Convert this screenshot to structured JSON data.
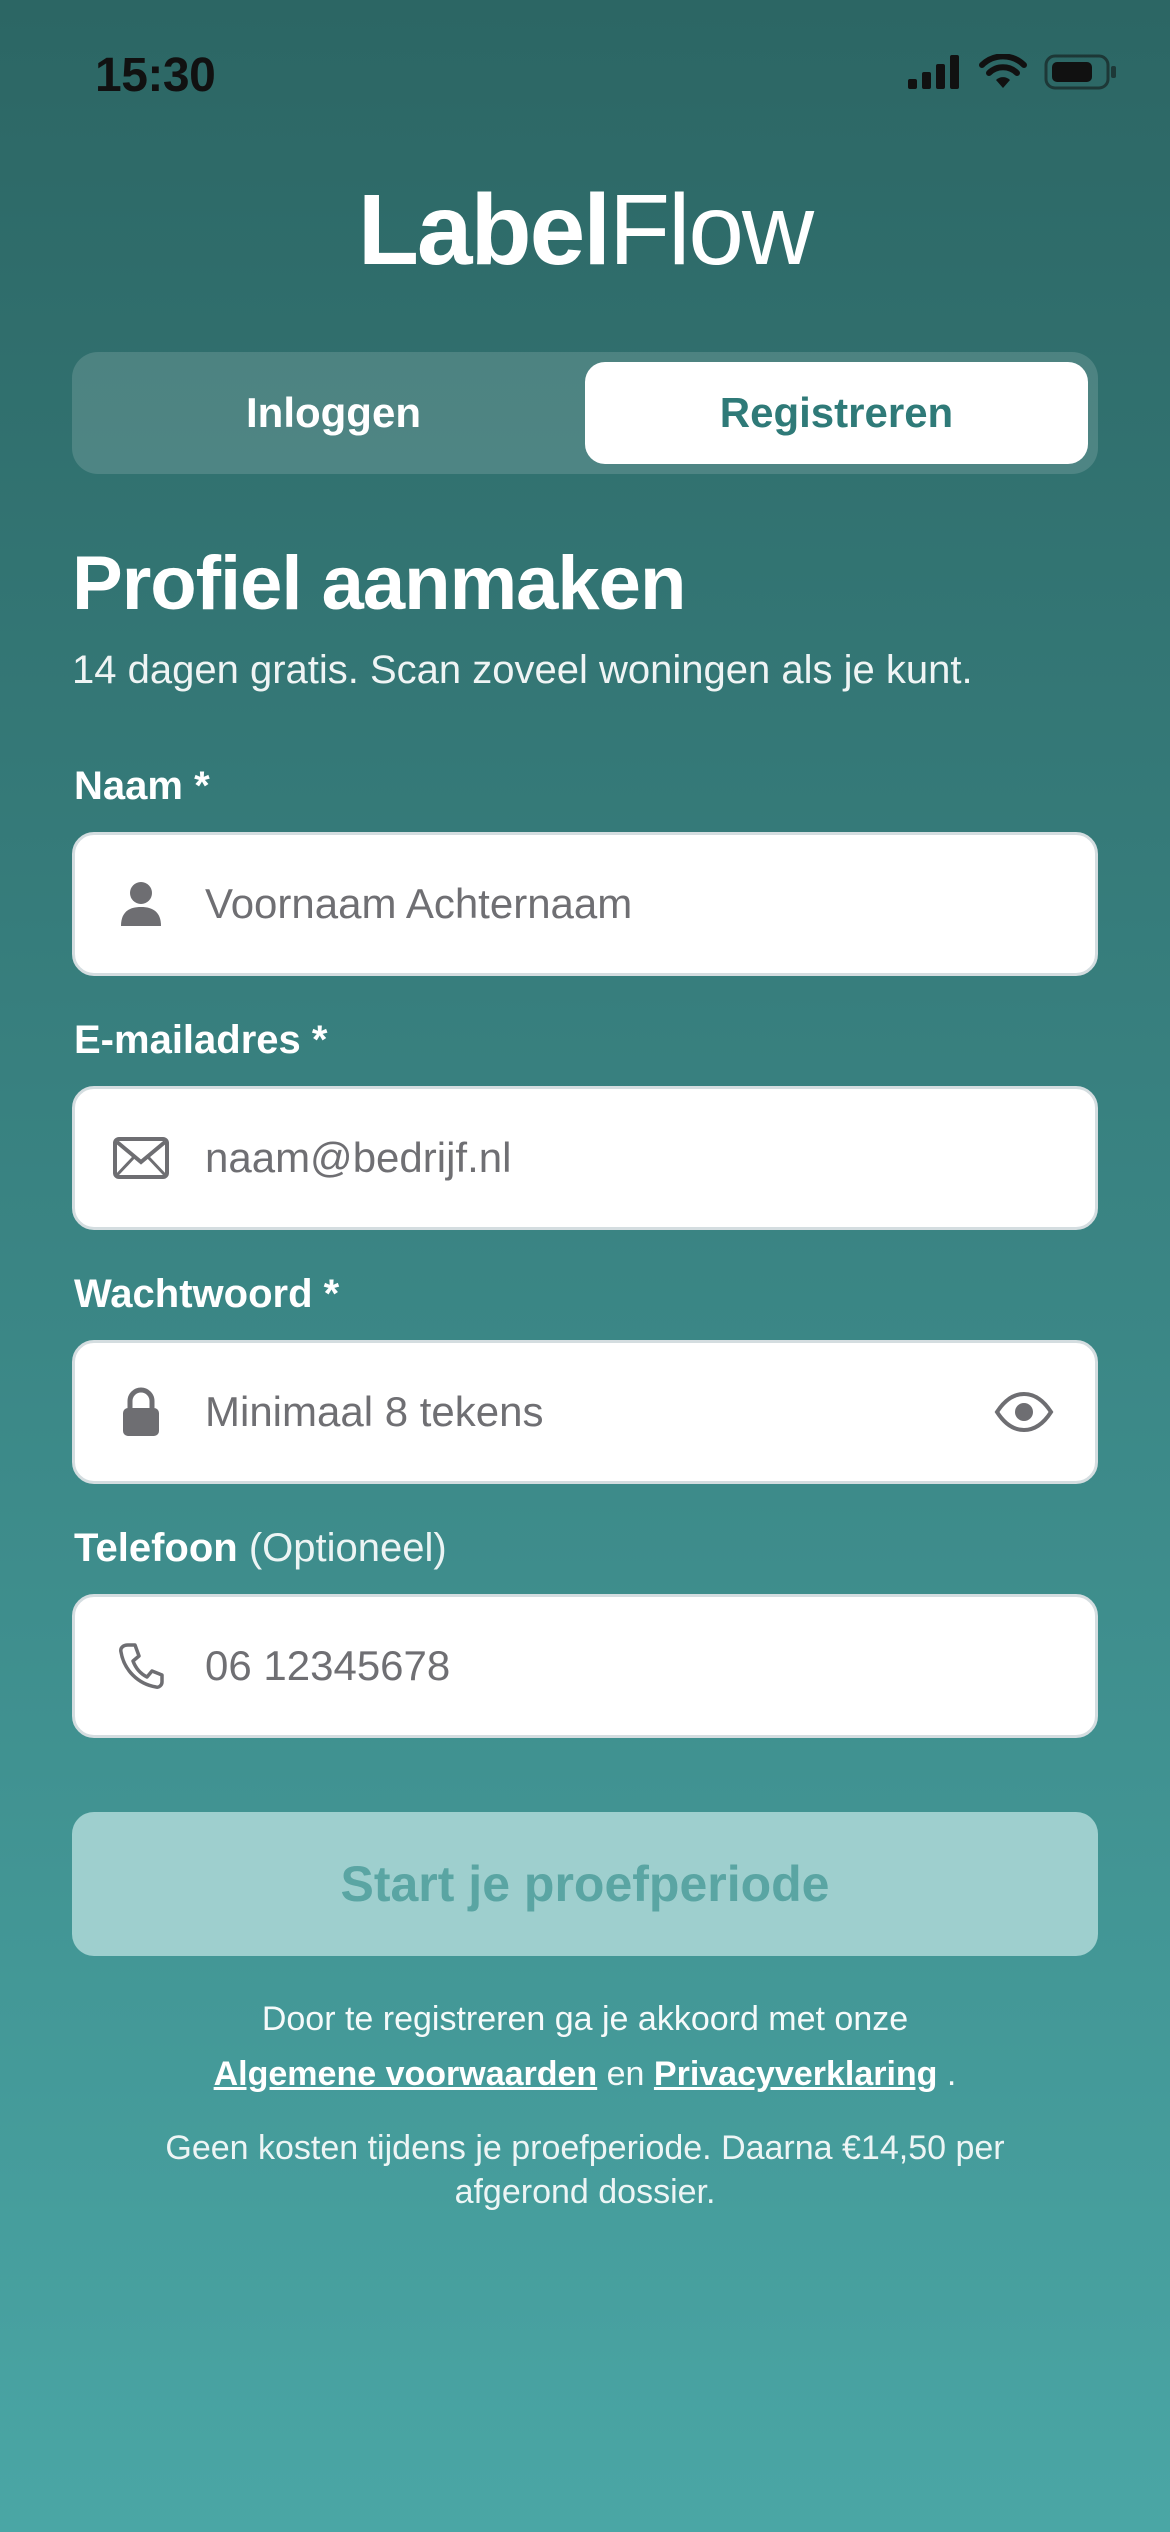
{
  "status_bar": {
    "time": "15:30"
  },
  "brand": {
    "name_bold": "Label",
    "name_light": "Flow"
  },
  "tabs": [
    {
      "label": "Inloggen",
      "active": false
    },
    {
      "label": "Registreren",
      "active": true
    }
  ],
  "form": {
    "title": "Profiel aanmaken",
    "subtitle": "14 dagen gratis. Scan zoveel woningen als je kunt.",
    "fields": {
      "name": {
        "label": "Naam",
        "required_mark": "*",
        "placeholder": "Voornaam Achternaam",
        "icon": "person-icon"
      },
      "email": {
        "label": "E-mailadres",
        "required_mark": "*",
        "placeholder": "naam@bedrijf.nl",
        "icon": "envelope-icon"
      },
      "password": {
        "label": "Wachtwoord",
        "required_mark": "*",
        "placeholder": "Minimaal 8 tekens",
        "icon": "lock-icon",
        "toggle_icon": "eye-icon"
      },
      "phone": {
        "label": "Telefoon",
        "optional_text": "(Optioneel)",
        "placeholder": "06 12345678",
        "icon": "phone-icon"
      }
    },
    "submit_label": "Start je proefperiode"
  },
  "legal": {
    "line1": "Door te registreren ga je akkoord met onze",
    "terms_link": "Algemene voorwaarden",
    "conjunction": "en",
    "privacy_link": "Privacyverklaring",
    "end": ".",
    "pricing_note": "Geen kosten tijdens je proefperiode. Daarna €14,50 per afgerond dossier."
  },
  "colors": {
    "background_top": "#2c6664",
    "background_bottom": "#4aa6a5",
    "accent": "#2f7a78",
    "button_disabled_bg": "#9ecfce",
    "button_disabled_text": "#5aa5a3"
  }
}
